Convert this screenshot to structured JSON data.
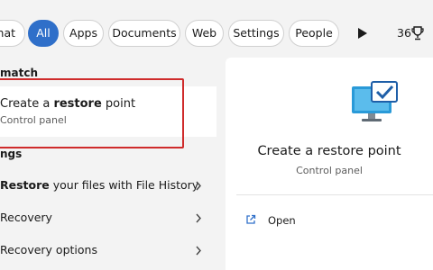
{
  "filters": {
    "chat": "hat",
    "all": "All",
    "apps": "Apps",
    "documents": "Documents",
    "web": "Web",
    "settings": "Settings",
    "people": "People"
  },
  "rewards": {
    "points": "36",
    "icon": "trophy-icon"
  },
  "results": {
    "best_match_header": "match",
    "best_match": {
      "title_prefix": "Create a ",
      "title_bold": "restore",
      "title_suffix": " point",
      "subtitle": "Control panel"
    },
    "settings_header": "ngs",
    "settings_items": [
      {
        "bold": "Restore",
        "rest": " your files with File History"
      },
      {
        "bold": "",
        "rest": "Recovery"
      },
      {
        "bold": "",
        "rest": "Recovery options"
      }
    ]
  },
  "detail": {
    "title": "Create a restore point",
    "subtitle": "Control panel",
    "icon": "monitor-check-icon",
    "actions": [
      {
        "label": "Open",
        "icon": "open-external-icon"
      }
    ]
  },
  "colors": {
    "accent": "#2f6fc9",
    "highlight": "#cf2b2b"
  }
}
